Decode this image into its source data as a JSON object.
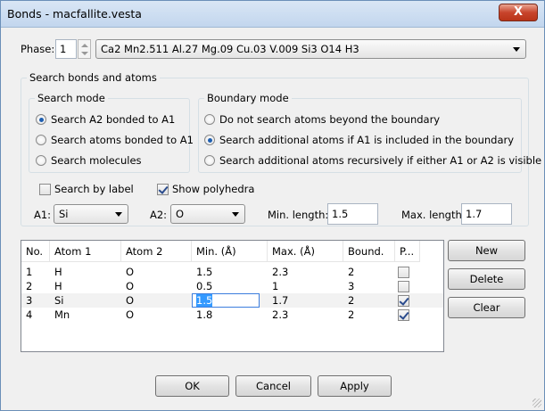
{
  "window": {
    "title": "Bonds - macfallite.vesta",
    "close_label": "X"
  },
  "phase": {
    "label": "Phase:",
    "value": "1",
    "selected": "Ca2 Mn2.511 Al.27 Mg.09 Cu.03 V.009 Si3 O14 H3"
  },
  "search_group": {
    "title": "Search bonds and atoms"
  },
  "search_mode": {
    "title": "Search mode",
    "options": [
      "Search A2 bonded to A1",
      "Search atoms bonded to A1",
      "Search molecules"
    ],
    "selected_index": 0
  },
  "boundary_mode": {
    "title": "Boundary mode",
    "options": [
      "Do not search atoms beyond the boundary",
      "Search additional atoms if A1 is included in the boundary",
      "Search additional atoms recursively if either A1 or A2 is visible"
    ],
    "selected_index": 1
  },
  "options": {
    "search_by_label": "Search by label",
    "search_by_label_checked": false,
    "show_polyhedra": "Show polyhedra",
    "show_polyhedra_checked": true
  },
  "a1": {
    "label": "A1:",
    "value": "Si"
  },
  "a2": {
    "label": "A2:",
    "value": "O"
  },
  "min_length": {
    "label": "Min. length:",
    "value": "1.5"
  },
  "max_length": {
    "label": "Max. length:",
    "value": "1.7"
  },
  "table": {
    "columns": [
      "No.",
      "Atom 1",
      "Atom 2",
      "Min. (Å)",
      "Max. (Å)",
      "Bound.",
      "P..."
    ],
    "rows": [
      {
        "no": "1",
        "atom1": "H",
        "atom2": "O",
        "min": "1.5",
        "max": "2.3",
        "bound": "2",
        "poly": false
      },
      {
        "no": "2",
        "atom1": "H",
        "atom2": "O",
        "min": "0.5",
        "max": "1",
        "bound": "3",
        "poly": false
      },
      {
        "no": "3",
        "atom1": "Si",
        "atom2": "O",
        "min": "1.5",
        "max": "1.7",
        "bound": "2",
        "poly": true
      },
      {
        "no": "4",
        "atom1": "Mn",
        "atom2": "O",
        "min": "1.8",
        "max": "2.3",
        "bound": "2",
        "poly": true
      }
    ],
    "selected_row": 2
  },
  "side_buttons": {
    "new": "New",
    "delete": "Delete",
    "clear": "Clear"
  },
  "footer": {
    "ok": "OK",
    "cancel": "Cancel",
    "apply": "Apply"
  }
}
